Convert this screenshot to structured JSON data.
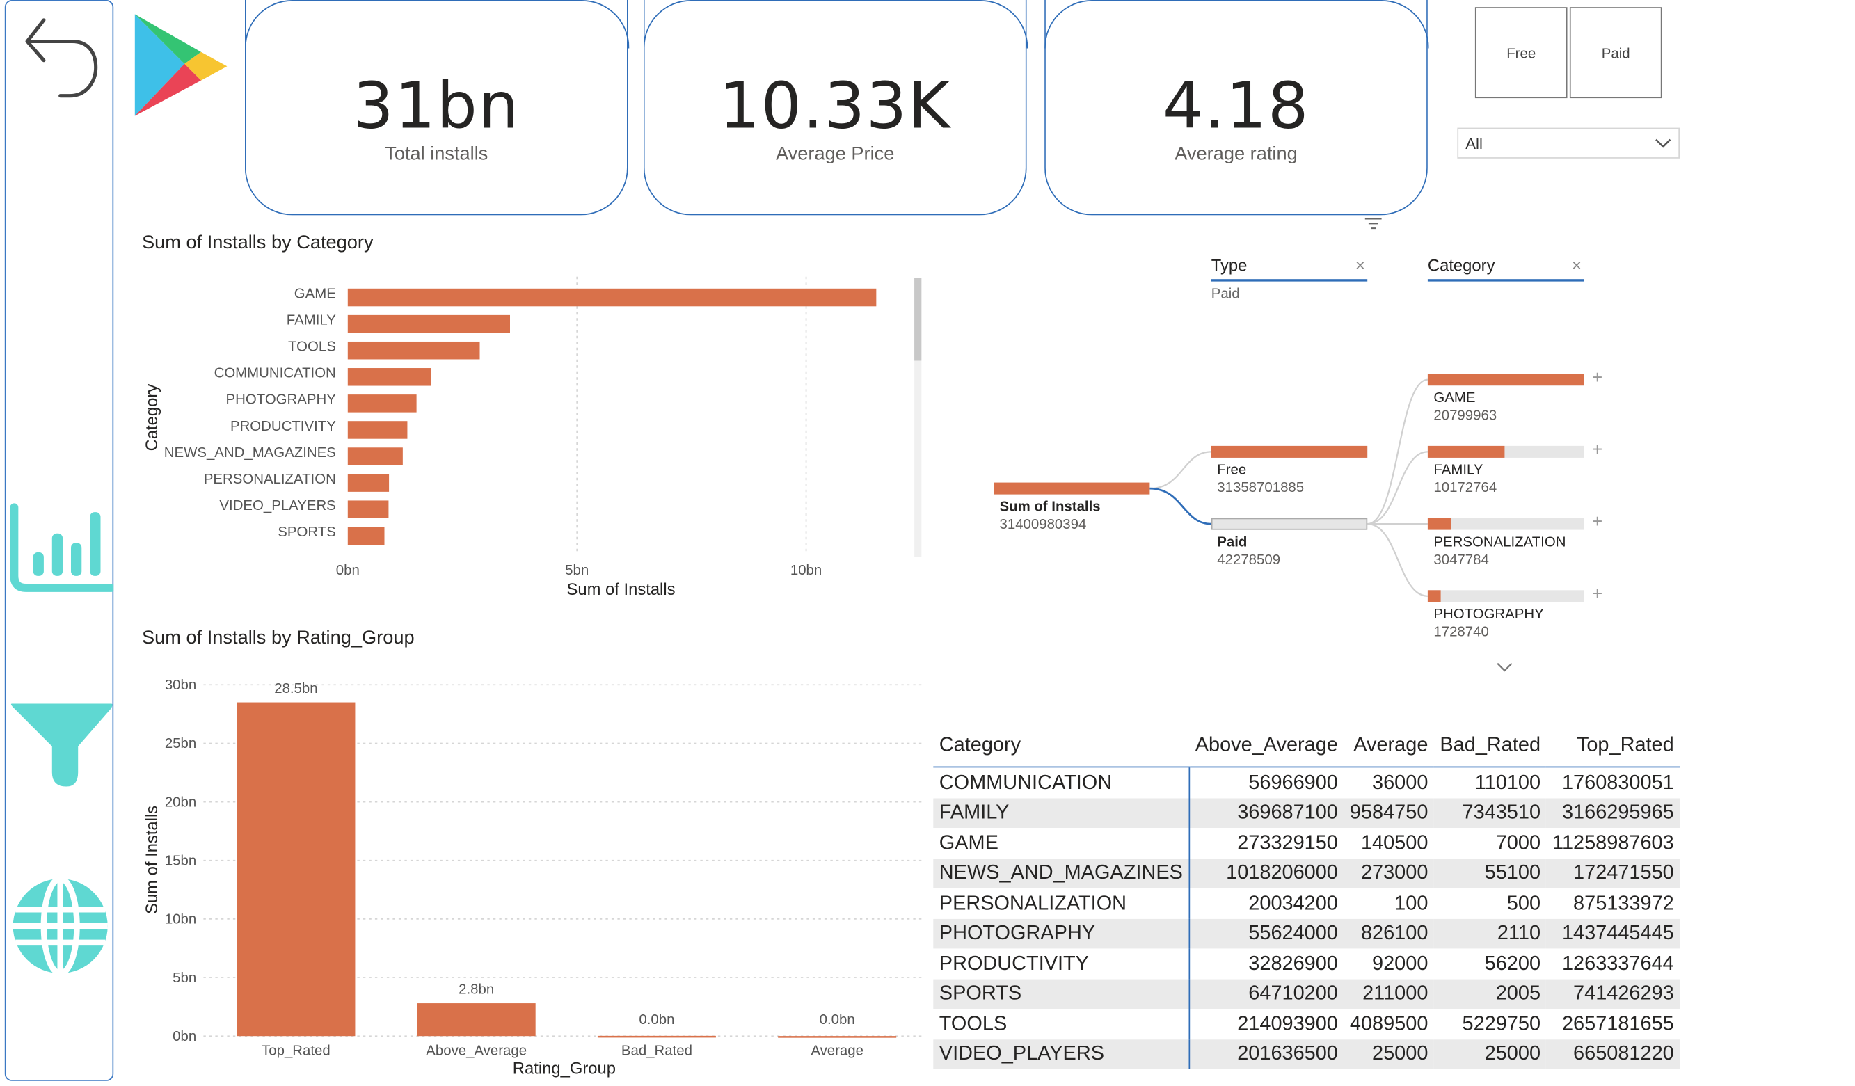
{
  "kpis": [
    {
      "value": "31bn",
      "label": "Total installs"
    },
    {
      "value": "10.33K",
      "label": "Average Price"
    },
    {
      "value": "4.18",
      "label": "Average rating"
    }
  ],
  "slicer": {
    "buttons": [
      "Free",
      "Paid"
    ],
    "dropdown_value": "All"
  },
  "category_chart": {
    "title": "Sum of Installs by Category",
    "chart_data": {
      "type": "bar",
      "orientation": "horizontal",
      "title": "Sum of Installs by Category",
      "xlabel": "Sum of Installs",
      "ylabel": "Category",
      "xlim": [
        0,
        12000000000
      ],
      "xticks": [
        "0bn",
        "5bn",
        "10bn"
      ],
      "grid": true,
      "categories": [
        "GAME",
        "FAMILY",
        "TOOLS",
        "COMMUNICATION",
        "PHOTOGRAPHY",
        "PRODUCTIVITY",
        "NEWS_AND_MAGAZINES",
        "PERSONALIZATION",
        "VIDEO_PLAYERS",
        "SPORTS"
      ],
      "values": [
        11530000000,
        3540000000,
        2880000000,
        1820000000,
        1500000000,
        1300000000,
        1200000000,
        900000000,
        890000000,
        800000000
      ]
    }
  },
  "rating_chart": {
    "title": "Sum of Installs by Rating_Group",
    "chart_data": {
      "type": "bar",
      "title": "Sum of Installs by Rating_Group",
      "xlabel": "Rating_Group",
      "ylabel": "Sum of Installs",
      "ylim": [
        0,
        30000000000
      ],
      "yticks": [
        "0bn",
        "5bn",
        "10bn",
        "15bn",
        "20bn",
        "25bn",
        "30bn"
      ],
      "grid": true,
      "categories": [
        "Top_Rated",
        "Above_Average",
        "Bad_Rated",
        "Average"
      ],
      "values": [
        28500000000,
        2800000000,
        20000000,
        5000000
      ],
      "data_labels": [
        "28.5bn",
        "2.8bn",
        "0.0bn",
        "0.0bn"
      ]
    }
  },
  "decomp_tree": {
    "filters": [
      {
        "name": "Type",
        "selected": "Paid"
      },
      {
        "name": "Category",
        "selected": ""
      }
    ],
    "root": {
      "label": "Sum of Installs",
      "value": "31400980394"
    },
    "level1": [
      {
        "label": "Free",
        "value": "31358701885",
        "fraction": 1.0,
        "selected": false
      },
      {
        "label": "Paid",
        "value": "42278509",
        "fraction": 0.0,
        "selected": true
      }
    ],
    "level2": [
      {
        "label": "GAME",
        "value": "20799963",
        "fraction": 1.0
      },
      {
        "label": "FAMILY",
        "value": "10172764",
        "fraction": 0.49
      },
      {
        "label": "PERSONALIZATION",
        "value": "3047784",
        "fraction": 0.15
      },
      {
        "label": "PHOTOGRAPHY",
        "value": "1728740",
        "fraction": 0.08
      }
    ]
  },
  "matrix": {
    "headers": [
      "Category",
      "Above_Average",
      "Average",
      "Bad_Rated",
      "Top_Rated"
    ],
    "rows": [
      [
        "COMMUNICATION",
        "56966900",
        "36000",
        "110100",
        "1760830051"
      ],
      [
        "FAMILY",
        "369687100",
        "9584750",
        "7343510",
        "3166295965"
      ],
      [
        "GAME",
        "273329150",
        "140500",
        "7000",
        "11258987603"
      ],
      [
        "NEWS_AND_MAGAZINES",
        "1018206000",
        "273000",
        "55100",
        "172471550"
      ],
      [
        "PERSONALIZATION",
        "20034200",
        "100",
        "500",
        "875133972"
      ],
      [
        "PHOTOGRAPHY",
        "55624000",
        "826100",
        "2110",
        "1437445445"
      ],
      [
        "PRODUCTIVITY",
        "32826900",
        "92000",
        "56200",
        "1263337644"
      ],
      [
        "SPORTS",
        "64710200",
        "211000",
        "2005",
        "741426293"
      ],
      [
        "TOOLS",
        "214093900",
        "4089500",
        "5229750",
        "2657181655"
      ],
      [
        "VIDEO_PLAYERS",
        "201636500",
        "25000",
        "25000",
        "665081220"
      ]
    ]
  },
  "colors": {
    "bar": "#d9714a",
    "accent_border": "#2f6db8",
    "nav_icons": "#5fd8d2",
    "grid": "#d6d6d6"
  },
  "icons": [
    "back-arrow-icon",
    "google-play-logo",
    "bar-chart-icon",
    "funnel-icon",
    "globe-icon",
    "filter-lines-icon",
    "chevron-down-icon",
    "close-icon",
    "plus-icon"
  ]
}
